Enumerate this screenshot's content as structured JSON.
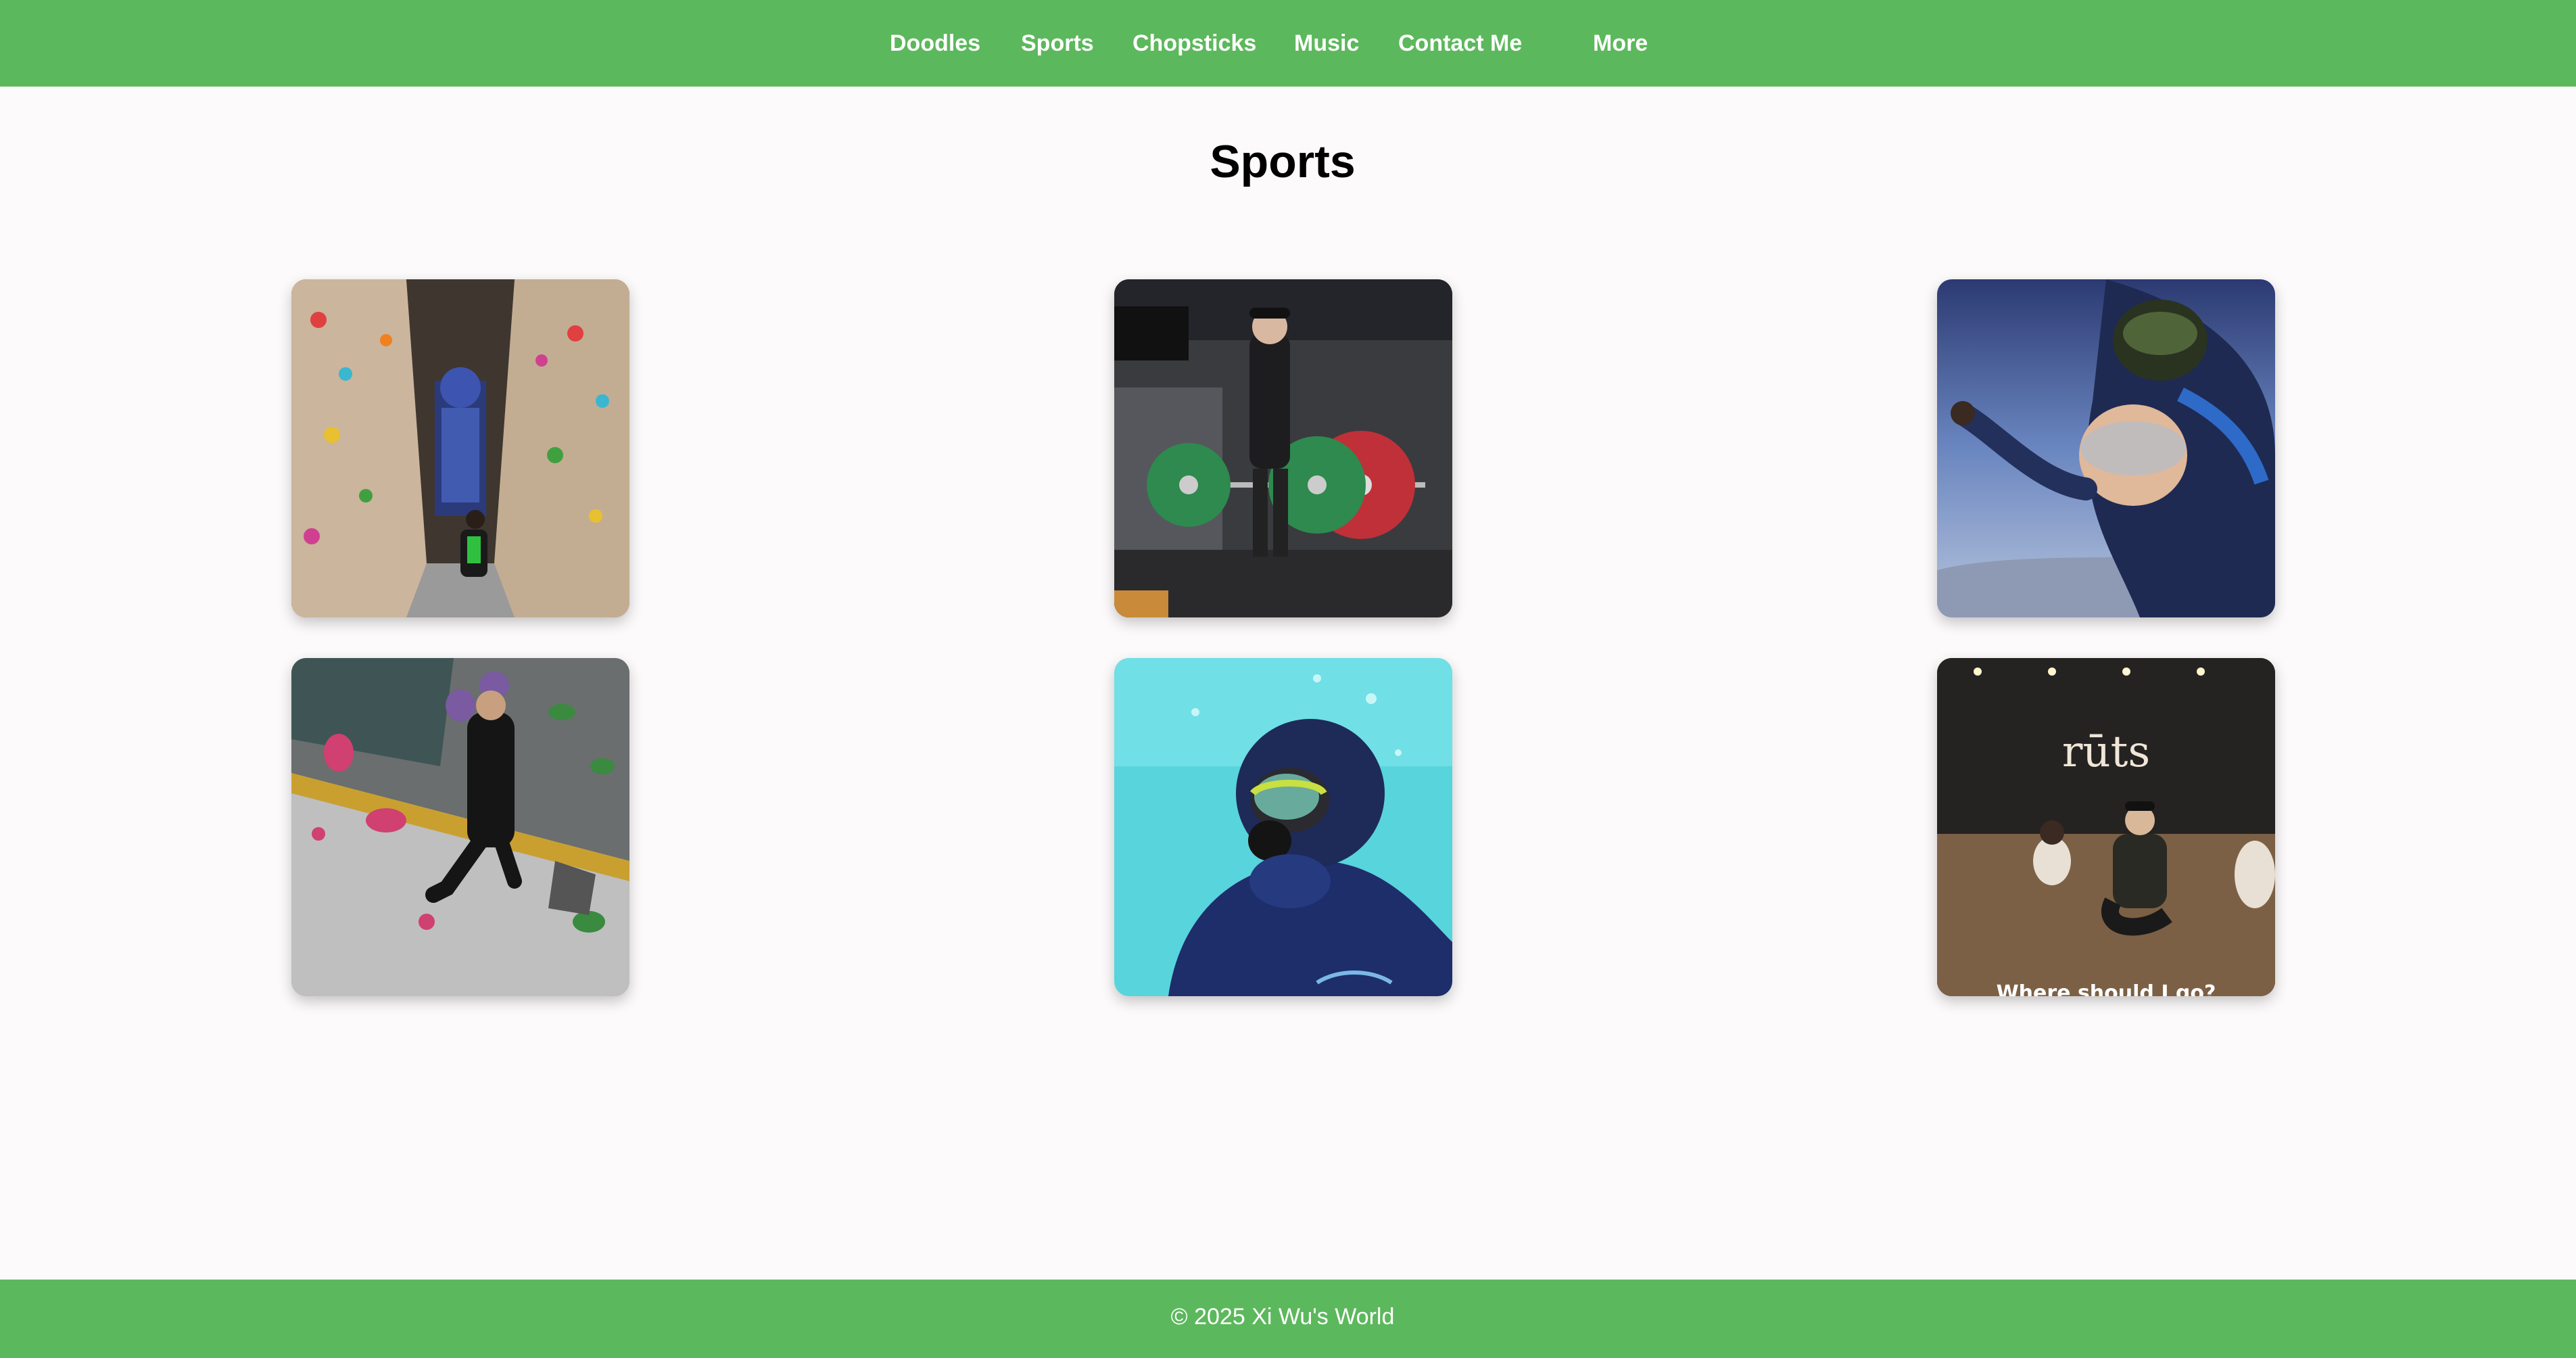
{
  "nav": {
    "items": [
      "Doodles",
      "Sports",
      "Chopsticks",
      "Music",
      "Contact Me",
      "More"
    ]
  },
  "page_title": "Sports",
  "gallery": {
    "photos": [
      {
        "subject": "indoor-climbing-gym"
      },
      {
        "subject": "deadlift-gym"
      },
      {
        "subject": "skydiving-tandem"
      },
      {
        "subject": "bouldering-wall"
      },
      {
        "subject": "scuba-diving"
      },
      {
        "subject": "dance-studio",
        "sign_text": "rūts",
        "caption_text": "Where should I go?"
      }
    ]
  },
  "footer": {
    "copyright": "© 2025 Xi Wu's World"
  },
  "colors": {
    "header_bg": "#5cb85c",
    "footer_bg": "#5cb85c",
    "page_bg": "#fcfafa",
    "nav_text": "#ffffff"
  }
}
